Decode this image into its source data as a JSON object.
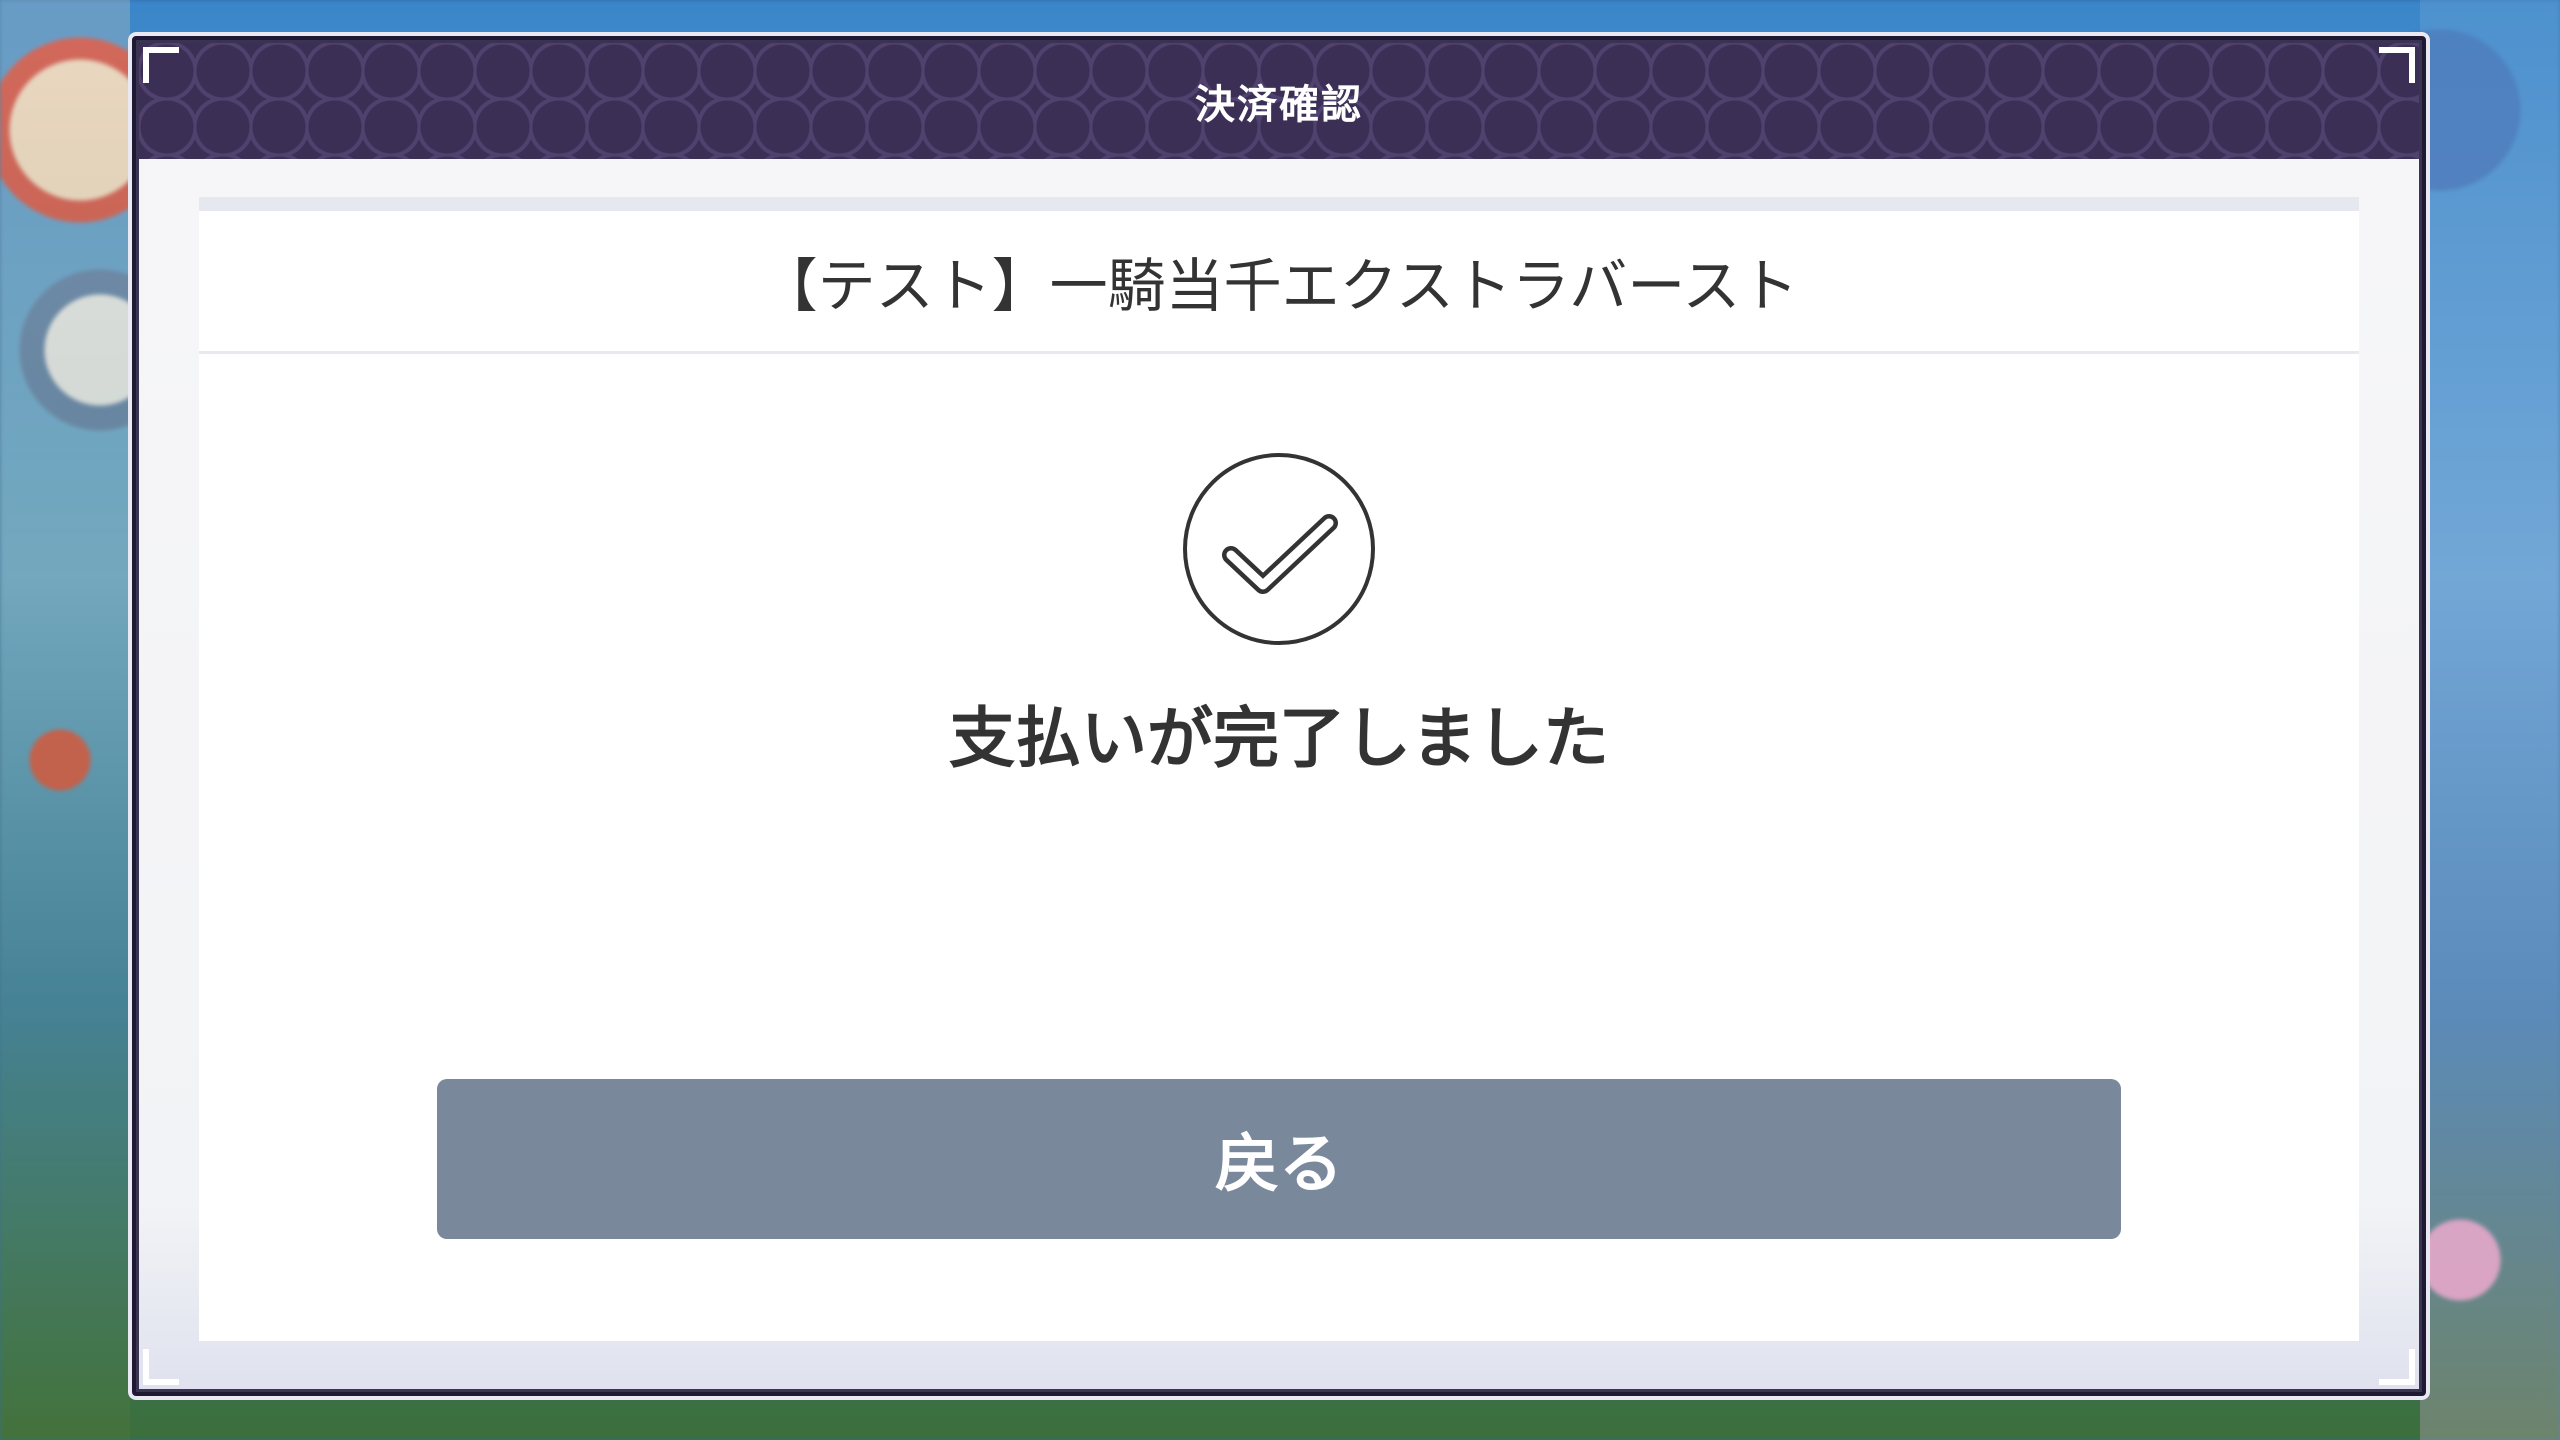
{
  "dialog": {
    "title": "決済確認",
    "product_name": "【テスト】一騎当千エクストラバースト",
    "status_icon": "check-circle-icon",
    "status_message": "支払いが完了しました",
    "back_button_label": "戻る"
  },
  "colors": {
    "header_bg": "#3b2f55",
    "button_bg": "#7a889c",
    "text": "#333333"
  }
}
